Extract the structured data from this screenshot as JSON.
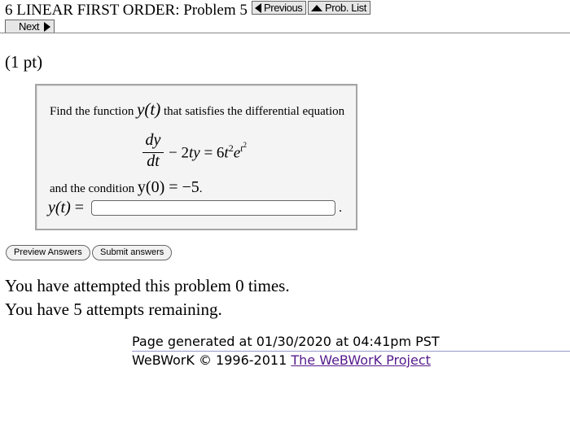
{
  "header": {
    "title": "6 LINEAR FIRST ORDER: Problem 5",
    "previous_label": "Previous",
    "prob_list_label": "Prob. List",
    "next_label": "Next"
  },
  "problem": {
    "points": "(1 pt)",
    "intro_text": "Find the function ",
    "fn": "y(t)",
    "intro_rest": " that satisfies the differential equation",
    "eq_num": "dy",
    "eq_den": "dt",
    "eq_rest_1": " − 2",
    "eq_rest_ty": "ty",
    "eq_rest_2": " = 6",
    "eq_t": "t",
    "eq_t_exp": "2",
    "eq_e": "e",
    "eq_e_exp_t": "t",
    "eq_e_exp_2": "2",
    "condition_text": "and the condition ",
    "condition_math": "y(0) = −5",
    "condition_end": ".",
    "answer_label_fn": "y(t)",
    "answer_label_eq": " = ",
    "answer_value": "",
    "answer_end": "."
  },
  "buttons": {
    "preview_label": "Preview Answers",
    "submit_label": "Submit answers"
  },
  "status": {
    "attempted": "You have attempted this problem 0 times.",
    "remaining": "You have 5 attempts remaining."
  },
  "footer": {
    "generated": "Page generated at 01/30/2020 at 04:41pm PST",
    "copyright": "WeBWorK © 1996-2011 ",
    "project_link": "The WeBWorK Project"
  }
}
